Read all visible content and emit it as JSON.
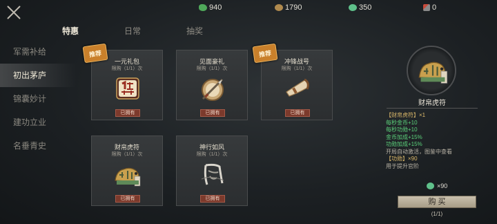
{
  "currencies": [
    {
      "icon": "leaf-icon",
      "value": "940"
    },
    {
      "icon": "copper-coin-icon",
      "value": "1790"
    },
    {
      "icon": "jade-icon",
      "value": "350"
    },
    {
      "icon": "token-icon",
      "value": "0"
    }
  ],
  "top_tabs": [
    "特惠",
    "日常",
    "抽奖"
  ],
  "sidebar": [
    "军需补给",
    "初出茅庐",
    "锦囊妙计",
    "建功立业",
    "名垂青史"
  ],
  "cards": [
    {
      "title": "一元礼包",
      "limit": "限购（1/1）次",
      "owned": "已拥有",
      "badge": "推荐",
      "icon": "one-yuan-gift-icon"
    },
    {
      "title": "见面豪礼",
      "limit": "限购（1/1）次",
      "owned": "已拥有",
      "badge": "",
      "icon": "scroll-sword-icon"
    },
    {
      "title": "冲锋战号",
      "limit": "限购（1/1）次",
      "owned": "已拥有",
      "badge": "推荐",
      "icon": "war-horn-icon"
    },
    {
      "title": "财帛虎符",
      "limit": "限购（1/1）次",
      "owned": "已拥有",
      "badge": "",
      "icon": "tiger-tally-icon"
    },
    {
      "title": "神行如风",
      "limit": "限购（1/1）次",
      "owned": "已拥有",
      "badge": "",
      "icon": "wind-calligraphy-icon"
    }
  ],
  "detail": {
    "name": "财帛虎符",
    "lines": [
      {
        "text": "【财帛虎符】×1",
        "color": "gold"
      },
      {
        "text": "每秒金币+10",
        "color": "green"
      },
      {
        "text": "每秒功勋+10",
        "color": "green"
      },
      {
        "text": "金币加成+15%",
        "color": "green"
      },
      {
        "text": "功勋加成+15%",
        "color": "green"
      },
      {
        "text": "开局自动激活，图鉴中查看",
        "color": "grey"
      },
      {
        "text": "【功勋】×90",
        "color": "gold"
      },
      {
        "text": "用于提升官阶",
        "color": "grey"
      }
    ],
    "price": "×90",
    "buy_label": "购 买",
    "buy_count": "(1/1)"
  }
}
